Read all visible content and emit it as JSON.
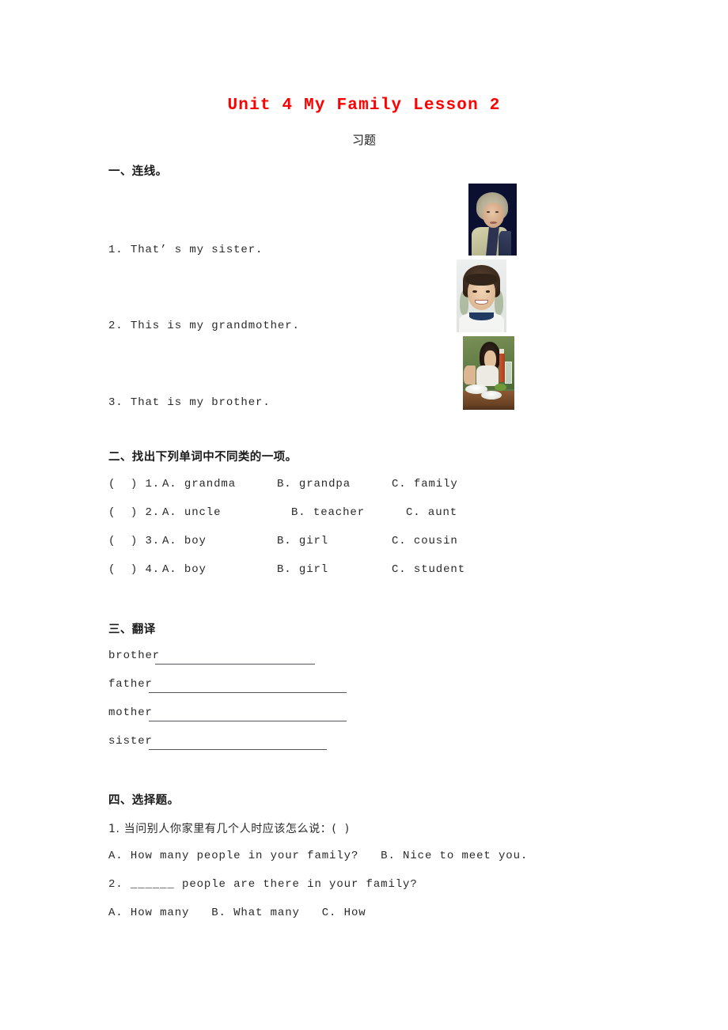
{
  "document": {
    "title": "Unit 4 My Family Lesson 2",
    "subtitle": "习题",
    "title_color": "#ff0000",
    "text_color": "#2a2a2a"
  },
  "section1": {
    "heading": "一、连线。",
    "items": [
      {
        "number": "1.",
        "text": "1. That’ s my sister."
      },
      {
        "number": "2.",
        "text": "2. This is my grandmother."
      },
      {
        "number": "3.",
        "text": "3. That is my brother."
      }
    ],
    "photos": [
      {
        "name": "grandmother-photo",
        "alt": "elderly woman with gray hair on dark navy background"
      },
      {
        "name": "boy-photo",
        "alt": "smiling child with short dark hair in white shirt"
      },
      {
        "name": "girl-eating-photo",
        "alt": "child eating at a table with plates and a drink"
      }
    ]
  },
  "section2": {
    "heading": "二、找出下列单词中不同类的一项。",
    "rows": [
      {
        "mark": "(  ) 1.",
        "a": "A. grandma",
        "b": "B. grandpa",
        "c": "C. family"
      },
      {
        "mark": "(  ) 2.",
        "a": "A. uncle",
        "b": "B. teacher",
        "c": "C. aunt"
      },
      {
        "mark": "(  ) 3.",
        "a": "A. boy",
        "b": "B. girl",
        "c": "C. cousin"
      },
      {
        "mark": "(  ) 4.",
        "a": "A. boy",
        "b": "B. girl",
        "c": "C. student"
      }
    ]
  },
  "section3": {
    "heading": "三、翻译",
    "words": [
      {
        "word": "brother",
        "answer": ""
      },
      {
        "word": "father",
        "answer": ""
      },
      {
        "word": "mother",
        "answer": ""
      },
      {
        "word": "sister",
        "answer": ""
      }
    ]
  },
  "section4": {
    "heading": "四、选择题。",
    "q1_prompt": "1. 当问别人你家里有几个人时应该怎么说：(  )",
    "q1_options": "A. How many people in your family?   B. Nice to meet you.",
    "q2_prompt_before": "2. ",
    "q2_blank": "______",
    "q2_prompt_after": " people are there in your family?",
    "q2_options": "A. How many   B. What many   C. How"
  }
}
